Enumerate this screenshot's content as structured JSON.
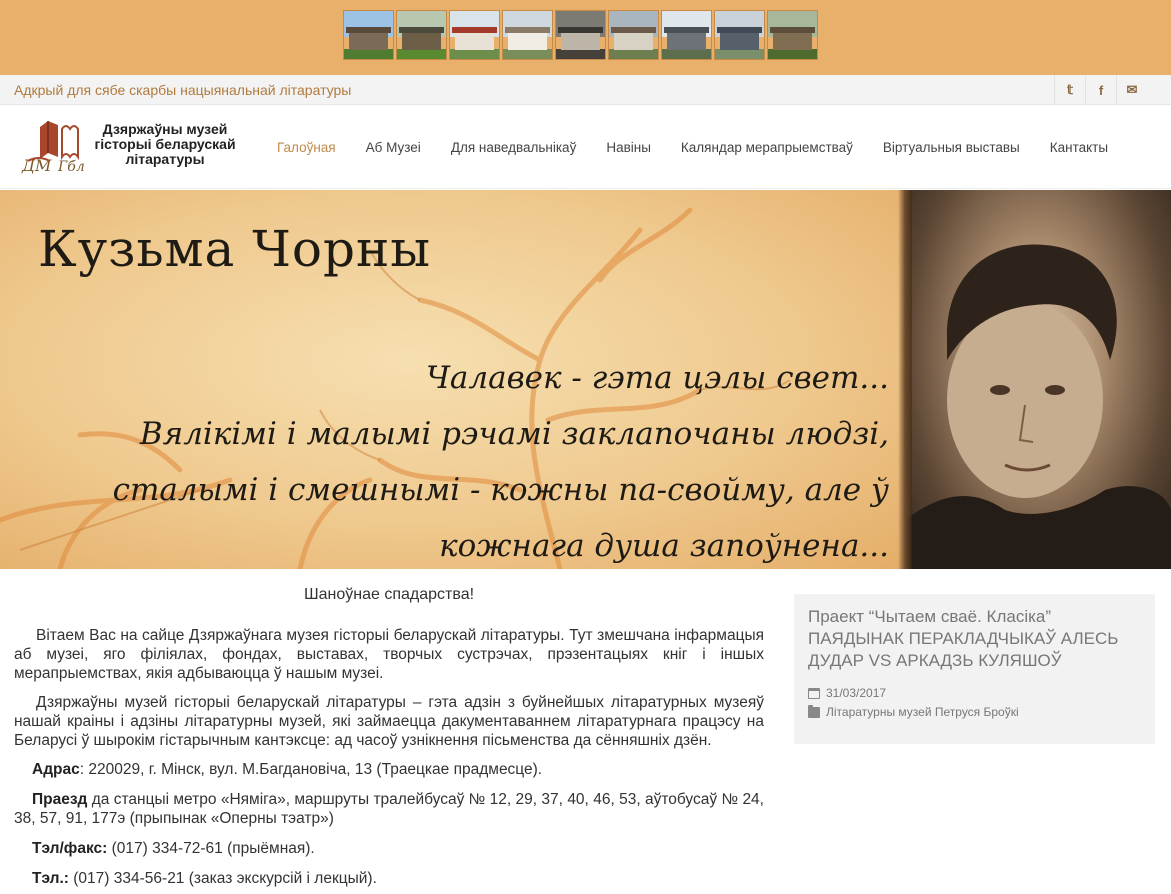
{
  "tagline": "Адкрый для сябе скарбы нацыянальнай літаратуры",
  "social": [
    {
      "icon": "twitter-icon",
      "glyph": "𝕥"
    },
    {
      "icon": "facebook-icon",
      "glyph": "f"
    },
    {
      "icon": "envelope-icon",
      "glyph": "✉"
    }
  ],
  "branch_thumbnails": [
    {
      "icon": "branch-photo-1",
      "sky": "#9cc3e6",
      "roof": "#5a4a3a",
      "wall": "#7b6a55",
      "ground": "#4f7d2f"
    },
    {
      "icon": "branch-photo-2",
      "sky": "#b7c7b0",
      "roof": "#4b4b3c",
      "wall": "#6d5f47",
      "ground": "#5a8a30"
    },
    {
      "icon": "branch-photo-3",
      "sky": "#d9e3ea",
      "roof": "#a33a2a",
      "wall": "#e8e2d6",
      "ground": "#6d8e4a"
    },
    {
      "icon": "branch-photo-4",
      "sky": "#cfd8de",
      "roof": "#8a7a6a",
      "wall": "#f1ede4",
      "ground": "#7a8e5a"
    },
    {
      "icon": "branch-photo-5",
      "sky": "#7d7a74",
      "roof": "#3a3632",
      "wall": "#bdb5a8",
      "ground": "#45413a"
    },
    {
      "icon": "branch-photo-6",
      "sky": "#a9b6bf",
      "roof": "#6b5a4a",
      "wall": "#d8d2c4",
      "ground": "#6e7f4f"
    },
    {
      "icon": "branch-photo-7",
      "sky": "#dfe6ec",
      "roof": "#4a5058",
      "wall": "#6c7278",
      "ground": "#5d6e4a"
    },
    {
      "icon": "branch-photo-8",
      "sky": "#c9d2d9",
      "roof": "#3f4a55",
      "wall": "#55606b",
      "ground": "#7a8f6a"
    },
    {
      "icon": "branch-photo-9",
      "sky": "#a7b89a",
      "roof": "#5d4e3a",
      "wall": "#806d52",
      "ground": "#4d6b2c"
    }
  ],
  "logo": {
    "line1": "Дзяржаўны музей",
    "line2": "гісторыі беларускай",
    "line3": "літаратуры"
  },
  "nav": [
    {
      "label": "Галоўная",
      "active": true
    },
    {
      "label": "Аб Музеі",
      "active": false
    },
    {
      "label": "Для наведвальнікаў",
      "active": false
    },
    {
      "label": "Навіны",
      "active": false
    },
    {
      "label": "Каляндар мерапрыемстваў",
      "active": false
    },
    {
      "label": "Віртуальныя выставы",
      "active": false
    },
    {
      "label": "Кантакты",
      "active": false
    }
  ],
  "hero": {
    "title": "Кузьма Чорны",
    "quote": [
      "Чалавек - гэта цэлы свет...",
      "Вялікімі і малымі рэчамі заклапочаны людзі,",
      "сталымі і смешнымі - кожны па-свойму, але ў",
      "кожнага душа запоўнена..."
    ]
  },
  "main": {
    "greeting": "Шаноўнае спадарства!",
    "para1": "Вітаем Вас на сайце Дзяржаўнага музея гісторыі беларускай літаратуры. Тут змешчана інфармацыя аб музеі, яго філіялах, фондах, выставах, творчых сустрэчах, прэзентацыях кніг і іншых мерапрыемствах, якія адбываюцца ў нашым музеі.",
    "para2": "Дзяржаўны музей гісторыі беларускай літаратуры – гэта адзін з буйнейшых літаратурных музеяў нашай краіны і адзіны літаратурны музей, які займаецца дакументаваннем літаратурнага працэсу на Беларусі ў шырокім гістарычным кантэксце: ад часоў узнікнення пісьменства да сённяшніх дзён.",
    "address_label": "Адрас",
    "address": ": 220029, г. Мінск, вул. М.Багдановіча, 13 (Траецкае прадмесце).",
    "transit_label": "Праезд",
    "transit": " да станцыі метро «Няміга», маршруты тралейбусаў № 12, 29, 37, 40, 46, 53, аўтобусаў № 24, 38, 57, 91, 177э (прыпынак «Оперны тэатр»)",
    "phonefax_label": "Тэл/факс:",
    "phonefax": " (017) 334-72-61 (прыёмная).",
    "phone_label": "Тэл.:",
    "phone": " (017) 334-56-21 (заказ экскурсій і лекцый)."
  },
  "news": {
    "title": "Праект “Чытаем сваё. Класіка” ПАЯДЫНАК ПЕРАКЛАДЧЫКАЎ АЛЕСЬ ДУДАР VS АРКАДЗЬ КУЛЯШОЎ",
    "date": "31/03/2017",
    "category": "Літаратурны музей Петруся Броўкі"
  }
}
